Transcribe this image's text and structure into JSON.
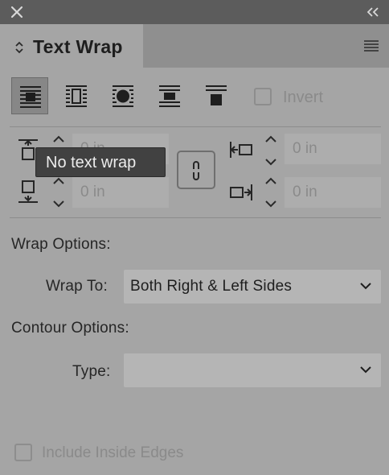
{
  "panel": {
    "title": "Text Wrap"
  },
  "wrap_types": [
    {
      "id": "none",
      "label": "No text wrap",
      "selected": true
    },
    {
      "id": "bounding-box",
      "label": "Wrap around bounding box",
      "selected": false
    },
    {
      "id": "object-shape",
      "label": "Wrap around object shape",
      "selected": false
    },
    {
      "id": "jump-object",
      "label": "Jump object",
      "selected": false
    },
    {
      "id": "jump-next-column",
      "label": "Jump to next column",
      "selected": false
    }
  ],
  "invert": {
    "label": "Invert",
    "checked": false
  },
  "offsets": {
    "top": "0 in",
    "bottom": "0 in",
    "left": "0 in",
    "right": "0 in"
  },
  "tooltip": "No text wrap",
  "wrap_options": {
    "heading": "Wrap Options:",
    "wrap_to_label": "Wrap To:",
    "wrap_to_value": "Both Right & Left Sides"
  },
  "contour_options": {
    "heading": "Contour Options:",
    "type_label": "Type:",
    "type_value": ""
  },
  "include_inside_edges": {
    "label": "Include Inside Edges",
    "checked": false
  },
  "colors": {
    "panel": "#a5a5a5",
    "titlebar": "#5c5c5c",
    "tooltip": "#414141",
    "selected": "#878787"
  }
}
